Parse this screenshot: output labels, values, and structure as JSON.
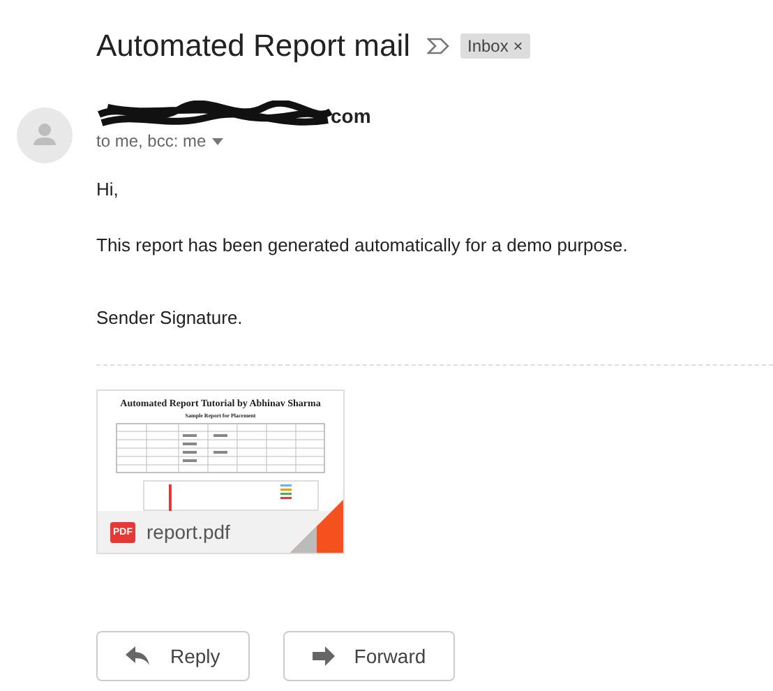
{
  "subject": "Automated Report mail",
  "label": {
    "text": "Inbox",
    "close": "×"
  },
  "sender": {
    "name_visible": "com",
    "recipients": "to me, bcc: me"
  },
  "body": [
    "Hi,",
    " This report has been generated automatically for a demo purpose.",
    "Sender Signature."
  ],
  "attachment": {
    "title": "Automated Report Tutorial by Abhinav Sharma",
    "subtitle": "Sample Report for Placement",
    "type": "PDF",
    "filename": "report.pdf"
  },
  "buttons": [
    {
      "kind": "reply",
      "label": "Reply"
    },
    {
      "kind": "forward",
      "label": "Forward"
    }
  ]
}
